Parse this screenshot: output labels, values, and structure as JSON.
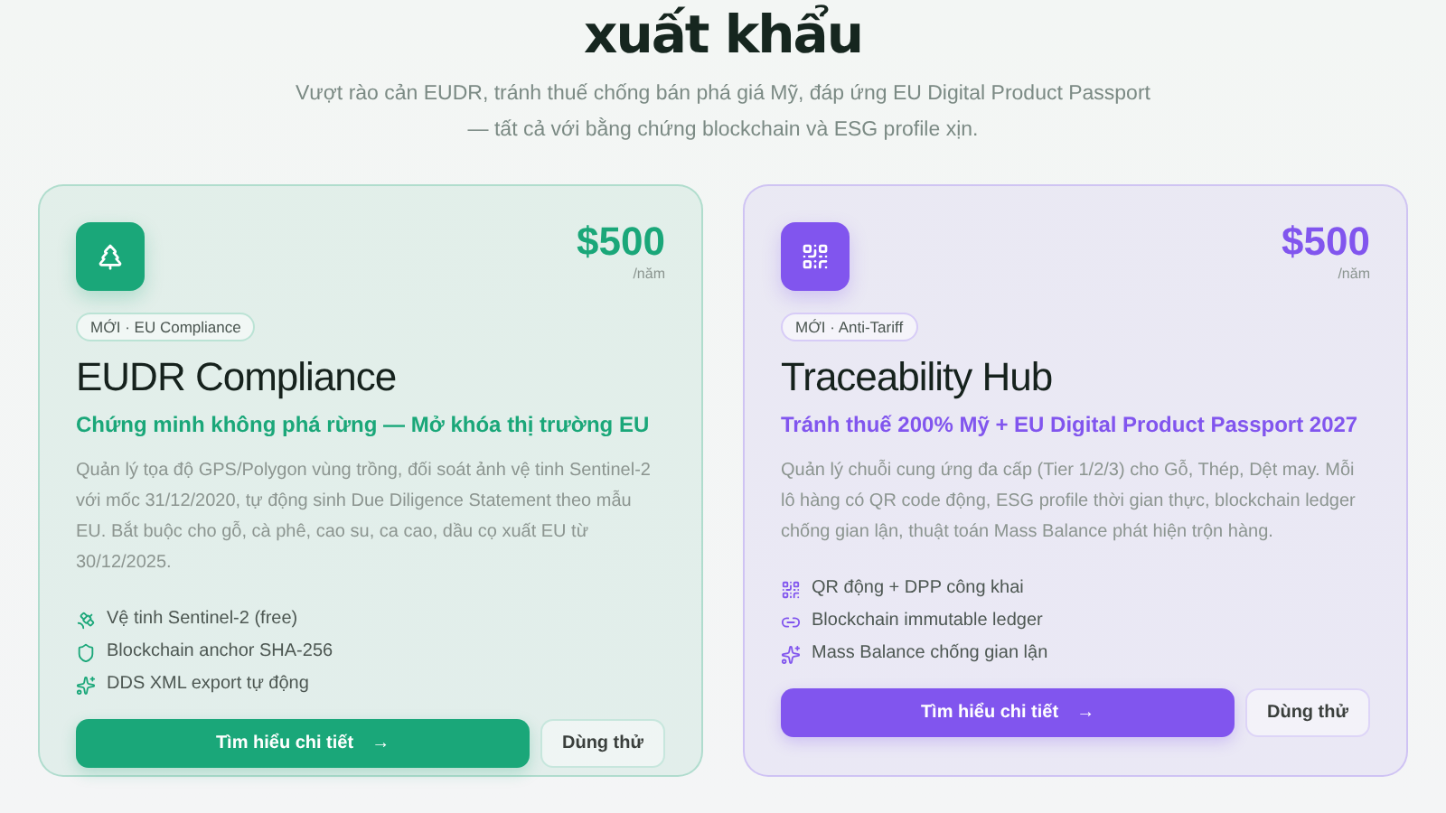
{
  "heading": "xuất khẩu",
  "subtitle": [
    "Vượt rào cản EUDR, tránh thuế chống bán phá giá Mỹ, đáp ứng EU Digital Product Passport",
    "— tất cả với bằng chứng blockchain và ESG profile xịn."
  ],
  "cards": [
    {
      "color": "#1aa779",
      "price": "$500",
      "period": "/năm",
      "badge": "MỚI · EU Compliance",
      "title": "EUDR Compliance",
      "tagline": "Chứng minh không phá rừng — Mở khóa thị trường EU",
      "description": "Quản lý tọa độ GPS/Polygon vùng trồng, đối soát ảnh vệ tinh Sentinel-2 với mốc 31/12/2020, tự động sinh Due Diligence Statement theo mẫu EU. Bắt buộc cho gỗ, cà phê, cao su, ca cao, dầu cọ xuất EU từ 30/12/2025.",
      "features": [
        "Vệ tinh Sentinel-2 (free)",
        "Blockchain anchor SHA-256",
        "DDS XML export tự động"
      ],
      "primary": "Tìm hiểu chi tiết",
      "arrow": "→",
      "secondary": "Dùng thử"
    },
    {
      "color": "#8155ee",
      "price": "$500",
      "period": "/năm",
      "badge": "MỚI · Anti-Tariff",
      "title": "Traceability Hub",
      "tagline": "Tránh thuế 200% Mỹ + EU Digital Product Passport 2027",
      "description": "Quản lý chuỗi cung ứng đa cấp (Tier 1/2/3) cho Gỗ, Thép, Dệt may. Mỗi lô hàng có QR code động, ESG profile thời gian thực, blockchain ledger chống gian lận, thuật toán Mass Balance phát hiện trộn hàng.",
      "features": [
        "QR động + DPP công khai",
        "Blockchain immutable ledger",
        "Mass Balance chống gian lận"
      ],
      "primary": "Tìm hiểu chi tiết",
      "arrow": "→",
      "secondary": "Dùng thử"
    }
  ]
}
